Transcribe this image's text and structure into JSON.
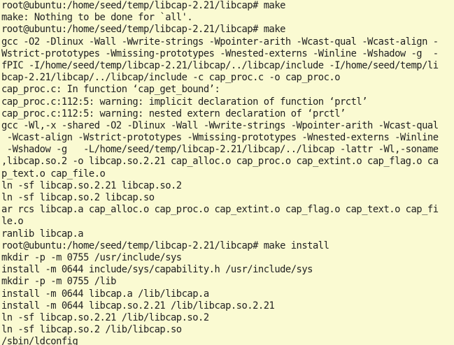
{
  "terminal": {
    "lines": [
      "root@ubuntu:/home/seed/temp/libcap-2.21/libcap# make",
      "make: Nothing to be done for `all'.",
      "root@ubuntu:/home/seed/temp/libcap-2.21/libcap# make",
      "gcc -O2 -Dlinux -Wall -Wwrite-strings -Wpointer-arith -Wcast-qual -Wcast-align -",
      "Wstrict-prototypes -Wmissing-prototypes -Wnested-externs -Winline -Wshadow -g  -",
      "fPIC -I/home/seed/temp/libcap-2.21/libcap/../libcap/include -I/home/seed/temp/li",
      "bcap-2.21/libcap/../libcap/include -c cap_proc.c -o cap_proc.o",
      "cap_proc.c: In function ‘cap_get_bound’:",
      "cap_proc.c:112:5: warning: implicit declaration of function ‘prctl’",
      "cap_proc.c:112:5: warning: nested extern declaration of ‘prctl’",
      "gcc -Wl,-x -shared -O2 -Dlinux -Wall -Wwrite-strings -Wpointer-arith -Wcast-qual",
      " -Wcast-align -Wstrict-prototypes -Wmissing-prototypes -Wnested-externs -Winline",
      " -Wshadow -g   -L/home/seed/temp/libcap-2.21/libcap/../libcap -lattr -Wl,-soname",
      ",libcap.so.2 -o libcap.so.2.21 cap_alloc.o cap_proc.o cap_extint.o cap_flag.o ca",
      "p_text.o cap_file.o",
      "ln -sf libcap.so.2.21 libcap.so.2",
      "ln -sf libcap.so.2 libcap.so",
      "ar rcs libcap.a cap_alloc.o cap_proc.o cap_extint.o cap_flag.o cap_text.o cap_fi",
      "le.o",
      "ranlib libcap.a",
      "root@ubuntu:/home/seed/temp/libcap-2.21/libcap# make install",
      "mkdir -p -m 0755 /usr/include/sys",
      "install -m 0644 include/sys/capability.h /usr/include/sys",
      "mkdir -p -m 0755 /lib",
      "install -m 0644 libcap.a /lib/libcap.a",
      "install -m 0644 libcap.so.2.21 /lib/libcap.so.2.21",
      "ln -sf libcap.so.2.21 /lib/libcap.so.2",
      "ln -sf libcap.so.2 /lib/libcap.so",
      "/sbin/ldconfig"
    ]
  },
  "colors": {
    "background": "#fafad2",
    "foreground": "#1f1f1f"
  }
}
